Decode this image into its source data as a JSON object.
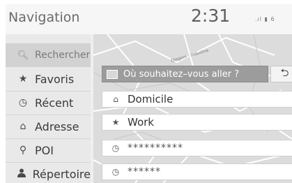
{
  "header": {
    "title": "Navigation",
    "clock": "2:31",
    "status": ".ıl ▮ 6"
  },
  "sidebar": {
    "items": [
      {
        "label": "Rechercher",
        "icon": "search-icon"
      },
      {
        "label": "Favoris",
        "icon": "star-icon"
      },
      {
        "label": "Récent",
        "icon": "clock-icon"
      },
      {
        "label": "Adresse",
        "icon": "address-icon"
      },
      {
        "label": "POI",
        "icon": "pin-icon"
      },
      {
        "label": "Répertoire",
        "icon": "person-icon"
      }
    ]
  },
  "search": {
    "placeholder": "Où souhaitez–vous aller ?"
  },
  "map": {
    "street_label": "Diegem - Industrie"
  },
  "destinations": [
    {
      "label": "Domicile",
      "icon": "home-icon"
    },
    {
      "label": "Work",
      "icon": "star-icon"
    },
    {
      "label": "**********",
      "icon": "clock-icon"
    },
    {
      "label": "******",
      "icon": "clock-icon"
    }
  ]
}
